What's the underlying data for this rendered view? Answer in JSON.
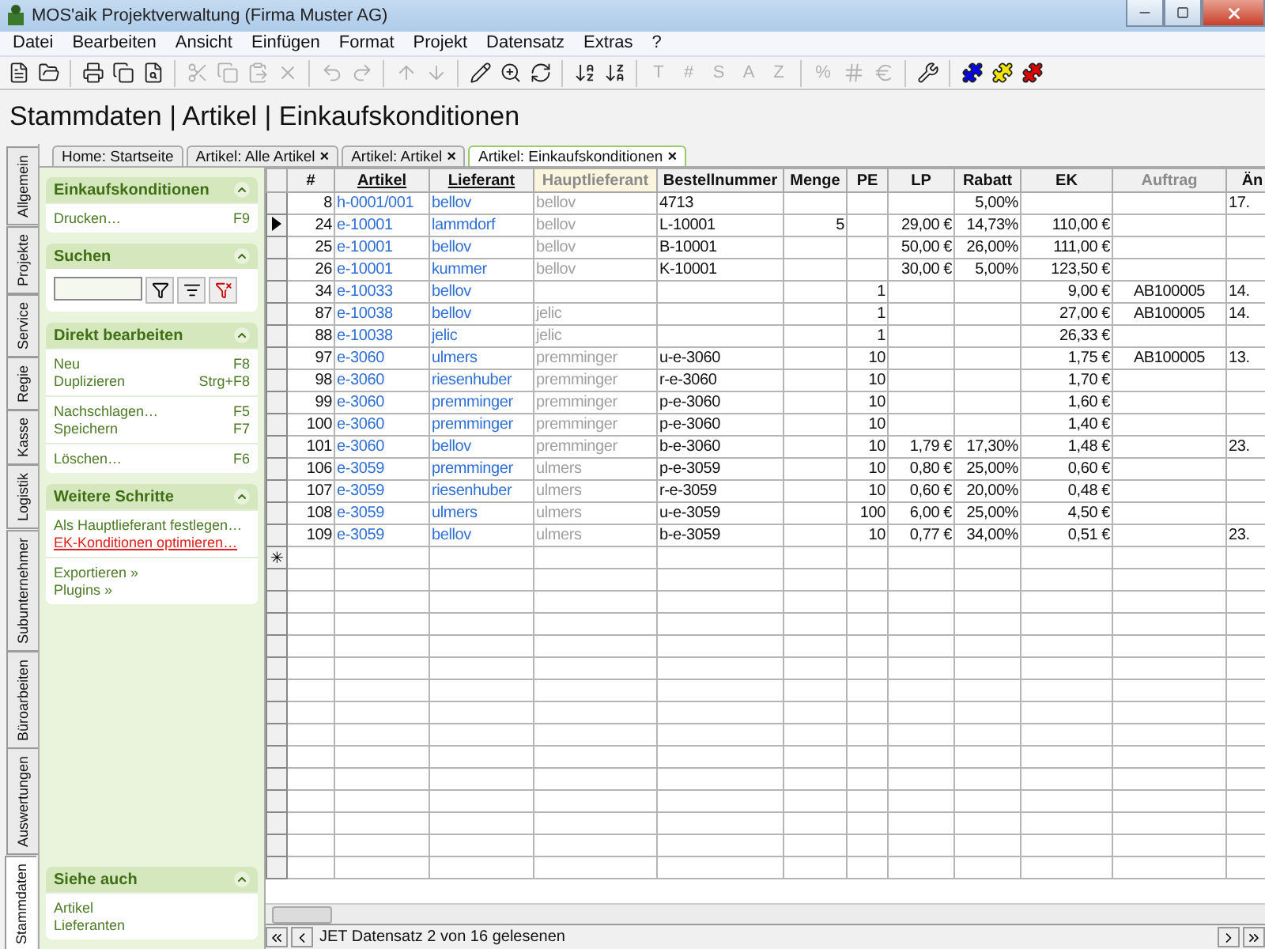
{
  "window": {
    "title": "MOS'aik Projektverwaltung (Firma Muster AG)"
  },
  "menu": [
    "Datei",
    "Bearbeiten",
    "Ansicht",
    "Einfügen",
    "Format",
    "Projekt",
    "Datensatz",
    "Extras",
    "?"
  ],
  "toolbar": [
    [
      {
        "kind": "icon",
        "disabled": false
      },
      {
        "kind": "icon",
        "disabled": false
      }
    ],
    [
      {
        "kind": "icon",
        "disabled": false
      },
      {
        "kind": "icon",
        "disabled": false
      },
      {
        "kind": "icon",
        "disabled": false
      }
    ],
    [
      {
        "kind": "icon",
        "disabled": true
      },
      {
        "kind": "icon",
        "disabled": true
      },
      {
        "kind": "icon",
        "disabled": true
      },
      {
        "kind": "icon",
        "disabled": true
      }
    ],
    [
      {
        "kind": "icon",
        "disabled": true
      },
      {
        "kind": "icon",
        "disabled": true
      }
    ],
    [
      {
        "kind": "icon",
        "disabled": true
      },
      {
        "kind": "icon",
        "disabled": true
      }
    ],
    [
      {
        "kind": "icon",
        "disabled": false
      },
      {
        "kind": "icon",
        "disabled": false
      },
      {
        "kind": "icon",
        "disabled": false
      }
    ],
    [
      {
        "kind": "icon",
        "disabled": false
      },
      {
        "kind": "icon",
        "disabled": false
      }
    ],
    [
      {
        "kind": "text",
        "label": "T",
        "disabled": true
      },
      {
        "kind": "text",
        "label": "#",
        "disabled": true
      },
      {
        "kind": "text",
        "label": "S",
        "disabled": true
      },
      {
        "kind": "text",
        "label": "A",
        "disabled": true
      },
      {
        "kind": "text",
        "label": "Z",
        "disabled": true
      }
    ],
    [
      {
        "kind": "text",
        "label": "%",
        "disabled": true
      },
      {
        "kind": "icon",
        "disabled": true
      },
      {
        "kind": "icon",
        "disabled": true
      }
    ],
    [
      {
        "kind": "icon",
        "disabled": false
      }
    ],
    [
      {
        "kind": "puzzle",
        "color": "#0000ee",
        "disabled": false
      },
      {
        "kind": "puzzle",
        "color": "#f2e600",
        "disabled": false
      },
      {
        "kind": "puzzle",
        "color": "#e00000",
        "disabled": false
      }
    ]
  ],
  "heading": "Stammdaten | Artikel | Einkaufskonditionen",
  "side_tabs": [
    {
      "label": "Allgemein",
      "selected": false
    },
    {
      "label": "Projekte",
      "selected": false
    },
    {
      "label": "Service",
      "selected": false
    },
    {
      "label": "Regie",
      "selected": false
    },
    {
      "label": "Kasse",
      "selected": false
    },
    {
      "label": "Logistik",
      "selected": false
    },
    {
      "label": "Subunternehmer",
      "selected": false
    },
    {
      "label": "Büroarbeiten",
      "selected": false
    },
    {
      "label": "Auswertungen",
      "selected": false
    },
    {
      "label": "Stammdaten",
      "selected": true
    }
  ],
  "doc_tabs": [
    {
      "label": "Home: Startseite",
      "closable": false,
      "selected": false
    },
    {
      "label": "Artikel: Alle Artikel",
      "closable": true,
      "selected": false
    },
    {
      "label": "Artikel: Artikel",
      "closable": true,
      "selected": false
    },
    {
      "label": "Artikel: Einkaufskonditionen",
      "closable": true,
      "selected": true
    }
  ],
  "close_glyph": "×",
  "sidebar": [
    {
      "title": "Einkaufskonditionen",
      "kind": "list",
      "groups": [
        [
          {
            "label": "Drucken…",
            "shortcut": "F9",
            "kind": "link"
          }
        ]
      ]
    },
    {
      "title": "Suchen",
      "kind": "search"
    },
    {
      "title": "Direkt bearbeiten",
      "kind": "list",
      "groups": [
        [
          {
            "label": "Neu",
            "shortcut": "F8",
            "kind": "link"
          },
          {
            "label": "Duplizieren",
            "shortcut": "Strg+F8",
            "kind": "link"
          }
        ],
        [
          {
            "label": "Nachschlagen…",
            "shortcut": "F5",
            "kind": "link"
          },
          {
            "label": "Speichern",
            "shortcut": "F7",
            "kind": "link"
          }
        ],
        [
          {
            "label": "Löschen…",
            "shortcut": "F6",
            "kind": "link"
          }
        ]
      ]
    },
    {
      "title": "Weitere Schritte",
      "kind": "list",
      "groups": [
        [
          {
            "label": "Als Hauptlieferant festlegen…",
            "kind": "link"
          },
          {
            "label": "EK-Konditionen optimieren…",
            "kind": "alert"
          }
        ],
        [
          {
            "label": "Exportieren »",
            "kind": "link"
          },
          {
            "label": "Plugins »",
            "kind": "link"
          }
        ]
      ]
    }
  ],
  "see_also": {
    "title": "Siehe auch",
    "items": [
      "Artikel",
      "Lieferanten"
    ]
  },
  "table": {
    "columns": [
      {
        "label": "#",
        "kind": "plain"
      },
      {
        "label": "Artikel",
        "kind": "underlined"
      },
      {
        "label": "Lieferant",
        "kind": "underlined"
      },
      {
        "label": "Hauptlieferant",
        "kind": "highlight"
      },
      {
        "label": "Bestellnummer",
        "kind": "plain"
      },
      {
        "label": "Menge",
        "kind": "plain"
      },
      {
        "label": "PE",
        "kind": "plain"
      },
      {
        "label": "LP",
        "kind": "plain"
      },
      {
        "label": "Rabatt",
        "kind": "plain"
      },
      {
        "label": "EK",
        "kind": "plain"
      },
      {
        "label": "Auftrag",
        "kind": "dimmed"
      },
      {
        "label": "Än",
        "kind": "plain"
      }
    ],
    "rows": [
      {
        "current": false,
        "cells": [
          "8",
          "h-0001/001",
          "bellov",
          "bellov",
          "4713",
          "",
          "",
          "",
          "5,00%",
          "",
          "",
          "17."
        ]
      },
      {
        "current": true,
        "cells": [
          "24",
          "e-10001",
          "lammdorf",
          "bellov",
          "L-10001",
          "5",
          "",
          "29,00 €",
          "14,73%",
          "110,00 €",
          "",
          ""
        ]
      },
      {
        "current": false,
        "cells": [
          "25",
          "e-10001",
          "bellov",
          "bellov",
          "B-10001",
          "",
          "",
          "50,00 €",
          "26,00%",
          "111,00 €",
          "",
          ""
        ]
      },
      {
        "current": false,
        "cells": [
          "26",
          "e-10001",
          "kummer",
          "bellov",
          "K-10001",
          "",
          "",
          "30,00 €",
          "5,00%",
          "123,50 €",
          "",
          ""
        ]
      },
      {
        "current": false,
        "cells": [
          "34",
          "e-10033",
          "bellov",
          "",
          "",
          "",
          "1",
          "",
          "",
          "9,00 €",
          "AB100005",
          "14."
        ]
      },
      {
        "current": false,
        "cells": [
          "87",
          "e-10038",
          "bellov",
          "jelic",
          "",
          "",
          "1",
          "",
          "",
          "27,00 €",
          "AB100005",
          "14."
        ]
      },
      {
        "current": false,
        "cells": [
          "88",
          "e-10038",
          "jelic",
          "jelic",
          "",
          "",
          "1",
          "",
          "",
          "26,33 €",
          "",
          ""
        ]
      },
      {
        "current": false,
        "cells": [
          "97",
          "e-3060",
          "ulmers",
          "premminger",
          "u-e-3060",
          "",
          "10",
          "",
          "",
          "1,75 €",
          "AB100005",
          "13."
        ]
      },
      {
        "current": false,
        "cells": [
          "98",
          "e-3060",
          "riesenhuber",
          "premminger",
          "r-e-3060",
          "",
          "10",
          "",
          "",
          "1,70 €",
          "",
          ""
        ]
      },
      {
        "current": false,
        "cells": [
          "99",
          "e-3060",
          "premminger",
          "premminger",
          "p-e-3060",
          "",
          "10",
          "",
          "",
          "1,60 €",
          "",
          ""
        ]
      },
      {
        "current": false,
        "cells": [
          "100",
          "e-3060",
          "premminger",
          "premminger",
          "p-e-3060",
          "",
          "10",
          "",
          "",
          "1,40 €",
          "",
          ""
        ]
      },
      {
        "current": false,
        "cells": [
          "101",
          "e-3060",
          "bellov",
          "premminger",
          "b-e-3060",
          "",
          "10",
          "1,79 €",
          "17,30%",
          "1,48 €",
          "",
          "23."
        ]
      },
      {
        "current": false,
        "cells": [
          "106",
          "e-3059",
          "premminger",
          "ulmers",
          "p-e-3059",
          "",
          "10",
          "0,80 €",
          "25,00%",
          "0,60 €",
          "",
          ""
        ]
      },
      {
        "current": false,
        "cells": [
          "107",
          "e-3059",
          "riesenhuber",
          "ulmers",
          "r-e-3059",
          "",
          "10",
          "0,60 €",
          "20,00%",
          "0,48 €",
          "",
          ""
        ]
      },
      {
        "current": false,
        "cells": [
          "108",
          "e-3059",
          "ulmers",
          "ulmers",
          "u-e-3059",
          "",
          "100",
          "6,00 €",
          "25,00%",
          "4,50 €",
          "",
          ""
        ]
      },
      {
        "current": false,
        "cells": [
          "109",
          "e-3059",
          "bellov",
          "ulmers",
          "b-e-3059",
          "",
          "10",
          "0,77 €",
          "34,00%",
          "0,51 €",
          "",
          "23."
        ]
      }
    ],
    "new_row_glyph": "✳"
  },
  "status_bar": "JET Datensatz 2 von 16 gelesenen"
}
